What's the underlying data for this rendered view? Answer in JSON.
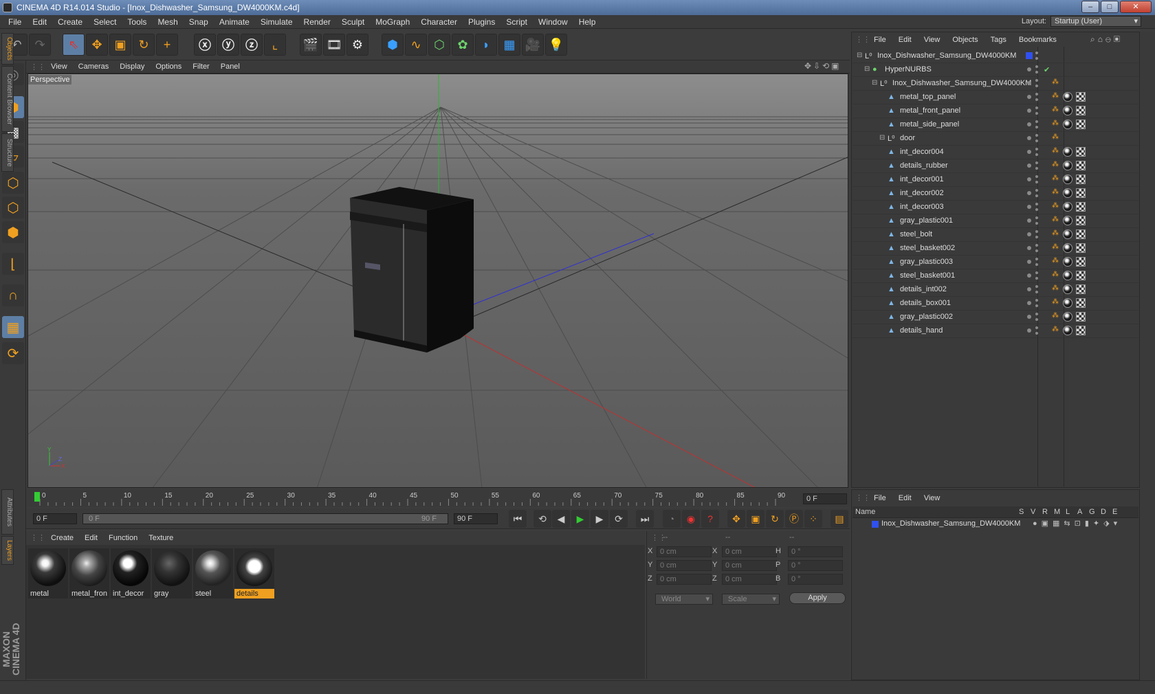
{
  "window": {
    "title": "CINEMA 4D R14.014 Studio - [Inox_Dishwasher_Samsung_DW4000KM.c4d]"
  },
  "menu": [
    "File",
    "Edit",
    "Create",
    "Select",
    "Tools",
    "Mesh",
    "Snap",
    "Animate",
    "Simulate",
    "Render",
    "Sculpt",
    "MoGraph",
    "Character",
    "Plugins",
    "Script",
    "Window",
    "Help"
  ],
  "layout": {
    "label": "Layout:",
    "value": "Startup (User)"
  },
  "viewport": {
    "menu": [
      "View",
      "Cameras",
      "Display",
      "Options",
      "Filter",
      "Panel"
    ],
    "label": "Perspective",
    "axis": {
      "y": "Y",
      "z": "Z",
      "x": "X"
    }
  },
  "timeline": {
    "ticks": [
      "0",
      "5",
      "10",
      "15",
      "20",
      "25",
      "30",
      "35",
      "40",
      "45",
      "50",
      "55",
      "60",
      "65",
      "70",
      "75",
      "80",
      "85",
      "90"
    ],
    "current_frame": "0 F",
    "start": "0 F",
    "range_start": "0 F",
    "range_end": "90 F",
    "end": "90 F"
  },
  "materials": {
    "menu": [
      "Create",
      "Edit",
      "Function",
      "Texture"
    ],
    "items": [
      {
        "name": "metal"
      },
      {
        "name": "metal_fron"
      },
      {
        "name": "int_decor"
      },
      {
        "name": "gray"
      },
      {
        "name": "steel"
      },
      {
        "name": "details"
      }
    ]
  },
  "coords": {
    "headers": [
      "--",
      "--",
      "--"
    ],
    "rows": [
      {
        "a": "X",
        "av": "0 cm",
        "b": "X",
        "bv": "0 cm",
        "c": "H",
        "cv": "0 °"
      },
      {
        "a": "Y",
        "av": "0 cm",
        "b": "Y",
        "bv": "0 cm",
        "c": "P",
        "cv": "0 °"
      },
      {
        "a": "Z",
        "av": "0 cm",
        "b": "Z",
        "bv": "0 cm",
        "c": "B",
        "cv": "0 °"
      }
    ],
    "space": "World",
    "mode": "Scale",
    "apply": "Apply"
  },
  "objects": {
    "menu": [
      "File",
      "Edit",
      "View",
      "Objects",
      "Tags",
      "Bookmarks"
    ],
    "rows": [
      {
        "name": "Inox_Dishwasher_Samsung_DW4000KM",
        "type": "null"
      },
      {
        "name": "HyperNURBS",
        "type": "nurbs"
      },
      {
        "name": "Inox_Dishwasher_Samsung_DW4000KM",
        "type": "null"
      },
      {
        "name": "metal_top_panel",
        "type": "poly"
      },
      {
        "name": "metal_front_panel",
        "type": "poly"
      },
      {
        "name": "metal_side_panel",
        "type": "poly"
      },
      {
        "name": "door",
        "type": "null"
      },
      {
        "name": "int_decor004",
        "type": "poly"
      },
      {
        "name": "details_rubber",
        "type": "poly"
      },
      {
        "name": "int_decor001",
        "type": "poly"
      },
      {
        "name": "int_decor002",
        "type": "poly"
      },
      {
        "name": "int_decor003",
        "type": "poly"
      },
      {
        "name": "gray_plastic001",
        "type": "poly"
      },
      {
        "name": "steel_bolt",
        "type": "poly"
      },
      {
        "name": "steel_basket002",
        "type": "poly"
      },
      {
        "name": "gray_plastic003",
        "type": "poly"
      },
      {
        "name": "steel_basket001",
        "type": "poly"
      },
      {
        "name": "details_int002",
        "type": "poly"
      },
      {
        "name": "details_box001",
        "type": "poly"
      },
      {
        "name": "gray_plastic002",
        "type": "poly"
      },
      {
        "name": "details_hand",
        "type": "poly"
      }
    ]
  },
  "layers": {
    "menu": [
      "File",
      "Edit",
      "View"
    ],
    "headers": {
      "name": "Name",
      "cols": [
        "S",
        "V",
        "R",
        "M",
        "L",
        "A",
        "G",
        "D",
        "E"
      ]
    },
    "row": "Inox_Dishwasher_Samsung_DW4000KM"
  },
  "sidetabs": [
    "Objects",
    "Content Browser",
    "Structure",
    "Attributes",
    "Layers"
  ],
  "brand": "MAXON CINEMA 4D",
  "colors": {
    "accent": "#f0a020",
    "selection": "#5e7fa5",
    "layer": "#3050f0"
  }
}
